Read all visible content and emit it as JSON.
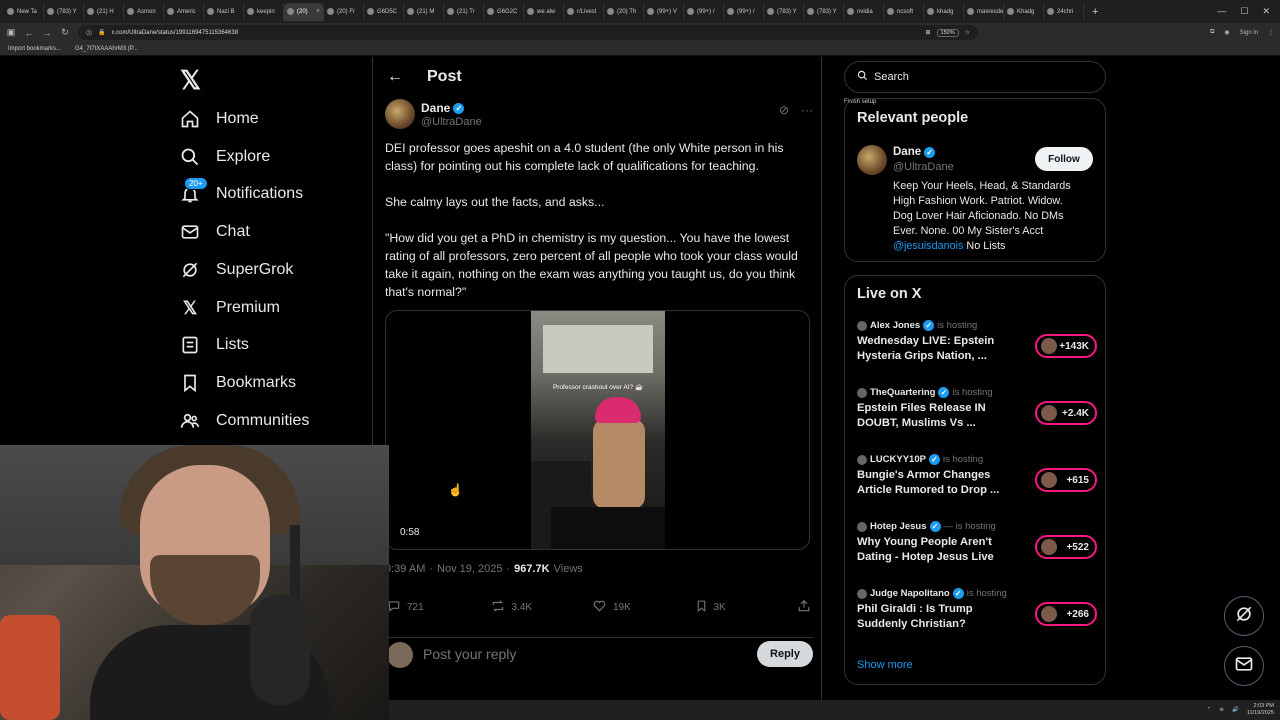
{
  "browser": {
    "tabs": [
      {
        "label": "New Ta"
      },
      {
        "label": "(783) Y"
      },
      {
        "label": "(21) H"
      },
      {
        "label": "Asmon"
      },
      {
        "label": "Americ"
      },
      {
        "label": "Nazi B"
      },
      {
        "label": "keepin"
      },
      {
        "label": "(20)"
      },
      {
        "label": "(20) Fr"
      },
      {
        "label": "G6D5C"
      },
      {
        "label": "(21) M"
      },
      {
        "label": "(21) Tr"
      },
      {
        "label": "G6G2C"
      },
      {
        "label": "we alw"
      },
      {
        "label": "r/Livest"
      },
      {
        "label": "(20) Th"
      },
      {
        "label": "(99+) V"
      },
      {
        "label": "(99+) /"
      },
      {
        "label": "(99+) /"
      },
      {
        "label": "(783) Y"
      },
      {
        "label": "(783) Y"
      },
      {
        "label": "nvidia"
      },
      {
        "label": "ncsoft"
      },
      {
        "label": "khadg"
      },
      {
        "label": "maxresdef"
      },
      {
        "label": "Khadg"
      },
      {
        "label": "24chri"
      }
    ],
    "active_tab_index": 7,
    "url": "x.com/UltraDane/status/1991169475115364638",
    "zoom": "150%",
    "sign_in": "Sign in",
    "bookmarks": [
      {
        "label": "Import bookmarks..."
      },
      {
        "label": "G4_7t7tXAAAhrM3 (P..."
      }
    ],
    "finish_setup": "Finish setup"
  },
  "nav": {
    "items": [
      {
        "label": "Home",
        "icon": "home-icon"
      },
      {
        "label": "Explore",
        "icon": "search-icon"
      },
      {
        "label": "Notifications",
        "icon": "bell-icon",
        "badge": "20+"
      },
      {
        "label": "Chat",
        "icon": "mail-icon"
      },
      {
        "label": "SuperGrok",
        "icon": "grok-icon"
      },
      {
        "label": "Premium",
        "icon": "x-icon"
      },
      {
        "label": "Lists",
        "icon": "list-icon"
      },
      {
        "label": "Bookmarks",
        "icon": "bookmark-icon"
      },
      {
        "label": "Communities",
        "icon": "people-icon"
      }
    ]
  },
  "post": {
    "header_title": "Post",
    "author_name": "Dane",
    "author_handle": "@UltraDane",
    "paragraphs": [
      "DEI professor goes apeshit on a 4.0 student (the only White person in his class) for pointing out his complete lack of qualifications for teaching.",
      "She calmy lays out the facts, and asks...",
      "\"How did you get a PhD in chemistry is my question... You have the lowest rating of all professors, zero percent of all people who took your class would take it again, nothing on the exam was anything you taught us, do you think that's normal?\""
    ],
    "video_caption": "Professor crashout over AI? ☕",
    "video_duration": "0:58",
    "time": "0:39 AM",
    "date": "Nov 19, 2025",
    "views_count": "967.7K",
    "views_label": "Views",
    "stats": {
      "replies": "721",
      "reposts": "3.4K",
      "likes": "19K",
      "bookmarks": "3K"
    },
    "reply_placeholder": "Post your reply",
    "reply_button": "Reply"
  },
  "sidebar": {
    "search_placeholder": "Search",
    "relevant_title": "Relevant people",
    "person": {
      "name": "Dane",
      "handle": "@UltraDane",
      "follow": "Follow",
      "bio_line1": "Keep Your Heels, Head, & Standards",
      "bio_line2": "High Fashion Work. Patriot. Widow.",
      "bio_line3": "Dog Lover Hair Aficionado. No DMs",
      "bio_line4": "Ever. None. 00 My Sister's Acct",
      "bio_link": "@jesuisdanois",
      "bio_tail": "No Lists"
    },
    "live_title": "Live on X",
    "live": [
      {
        "host": "Alex Jones",
        "status": "is hosting",
        "title": "Wednesday LIVE: Epstein Hysteria Grips Nation, ...",
        "count": "+143K"
      },
      {
        "host": "TheQuartering",
        "status": "is hosting",
        "title": "Epstein Files Release IN DOUBT,  Muslims Vs ...",
        "count": "+2.4K"
      },
      {
        "host": "LUCKYY10P",
        "status": "is hosting",
        "title": "Bungie's Armor Changes Article Rumored to Drop ...",
        "count": "+615"
      },
      {
        "host": "Hotep Jesus",
        "status": "— is hosting",
        "title": "Why Young People Aren't Dating - Hotep Jesus Live",
        "count": "+522"
      },
      {
        "host": "Judge Napolitano",
        "status": "is hosting",
        "title": "Phil Giraldi  : Is Trump Suddenly Christian?",
        "count": "+266"
      }
    ],
    "show_more": "Show more"
  },
  "taskbar": {
    "time": "2:03 PM",
    "date": "11/19/2025"
  },
  "colors": {
    "accent": "#1d9bf0",
    "live_ring": "#f91880",
    "border": "#2f3336",
    "muted": "#71767b"
  }
}
